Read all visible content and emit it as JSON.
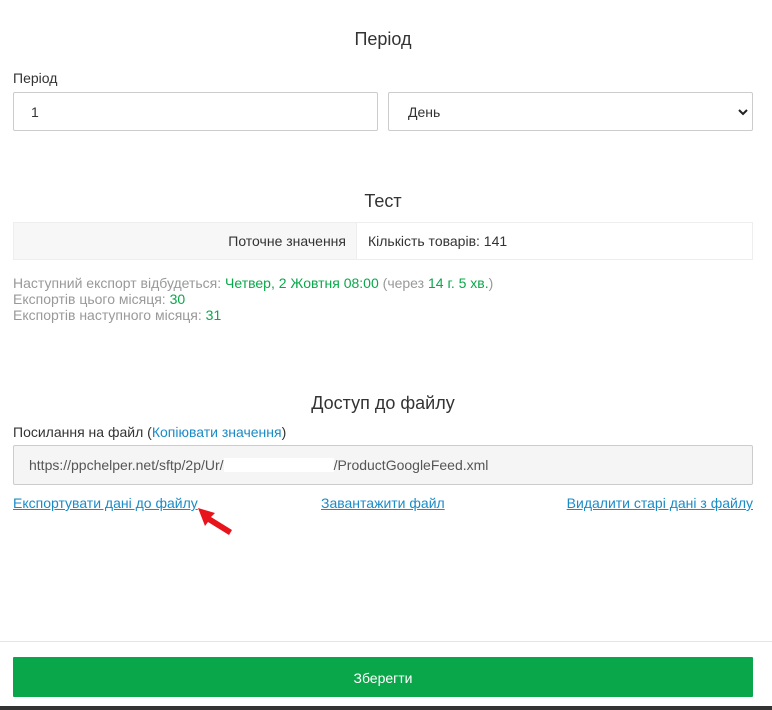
{
  "period_section": {
    "title": "Період",
    "field_label": "Період",
    "amount_value": "1",
    "unit_selected": "День"
  },
  "test_section": {
    "title": "Тест",
    "row_label": "Поточне значення",
    "row_value": "Кількість товарів: 141"
  },
  "schedule": {
    "next_export_prefix": "Наступний експорт відбудеться: ",
    "next_export_date": "Четвер, 2 Жовтня 08:00",
    "in_prefix": " (через ",
    "in_value": "14 г. 5 хв.",
    "in_suffix": ")",
    "this_month_label": "Експортів цього місяця: ",
    "this_month_value": "30",
    "next_month_label": "Експортів наступного місяця: ",
    "next_month_value": "31"
  },
  "access_section": {
    "title": "Доступ до файлу",
    "link_label": "Посилання на файл",
    "open_paren": " (",
    "copy_link": "Копіювати значення",
    "close_paren": ")",
    "url_start": "https://ppchelper.net/sftp/2p/Ur/",
    "url_end": "/ProductGoogleFeed.xml",
    "export_link": "Експортувати дані до файлу",
    "download_link": "Завантажити файл",
    "delete_link": "Видалити старі дані з файлу"
  },
  "footer": {
    "save_label": "Зберегти",
    "accent": "#0aa74a"
  },
  "colors": {
    "green_text": "#09a84a",
    "link": "#1a8bc7",
    "arrow": "#e8141c"
  }
}
